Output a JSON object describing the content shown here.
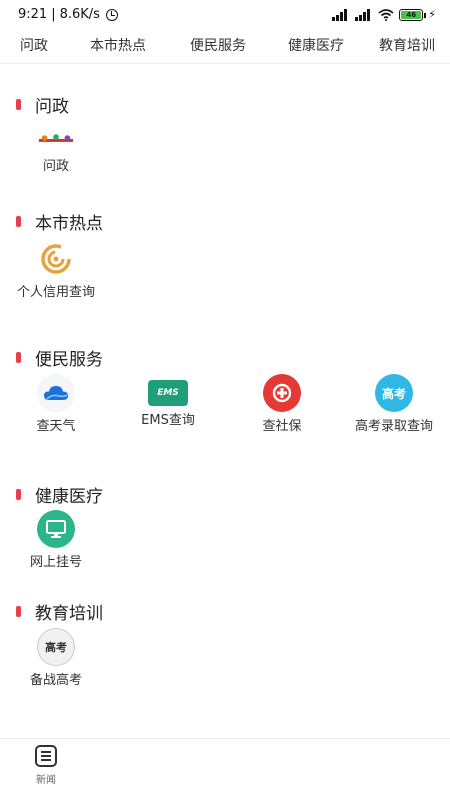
{
  "status_bar": {
    "time": "9:21",
    "speed": "8.6K/s",
    "battery_level": "46"
  },
  "tabs": [
    {
      "label": "问政"
    },
    {
      "label": "本市热点"
    },
    {
      "label": "便民服务"
    },
    {
      "label": "健康医疗"
    },
    {
      "label": "教育培训"
    }
  ],
  "sections": {
    "wenzheng": {
      "title": "问政",
      "items": [
        {
          "label": "问政",
          "icon": "wenzheng-logo-icon"
        }
      ]
    },
    "hotspot": {
      "title": "本市热点",
      "items": [
        {
          "label": "个人信用查询",
          "icon": "credit-icon"
        }
      ]
    },
    "service": {
      "title": "便民服务",
      "items": [
        {
          "label": "查天气",
          "icon": "weather-icon"
        },
        {
          "label": "EMS查询",
          "icon": "ems-icon"
        },
        {
          "label": "查社保",
          "icon": "social-security-icon"
        },
        {
          "label": "高考录取查询",
          "icon": "gaokao-icon"
        }
      ]
    },
    "health": {
      "title": "健康医疗",
      "items": [
        {
          "label": "网上挂号",
          "icon": "monitor-icon"
        }
      ]
    },
    "education": {
      "title": "教育培训",
      "items": [
        {
          "label": "备战高考",
          "icon": "exam-icon"
        }
      ]
    }
  },
  "icon_text": {
    "ems": "EMS",
    "gaokao": "高考",
    "exam": "高考"
  },
  "bottom_nav": {
    "news_label": "新闻"
  },
  "colors": {
    "accent": "#e8404a",
    "credit": "#e6a23c",
    "ems": "#1f9e7a",
    "social": "#e53935",
    "gaokao": "#2fb8e6",
    "monitor": "#2db58a"
  }
}
